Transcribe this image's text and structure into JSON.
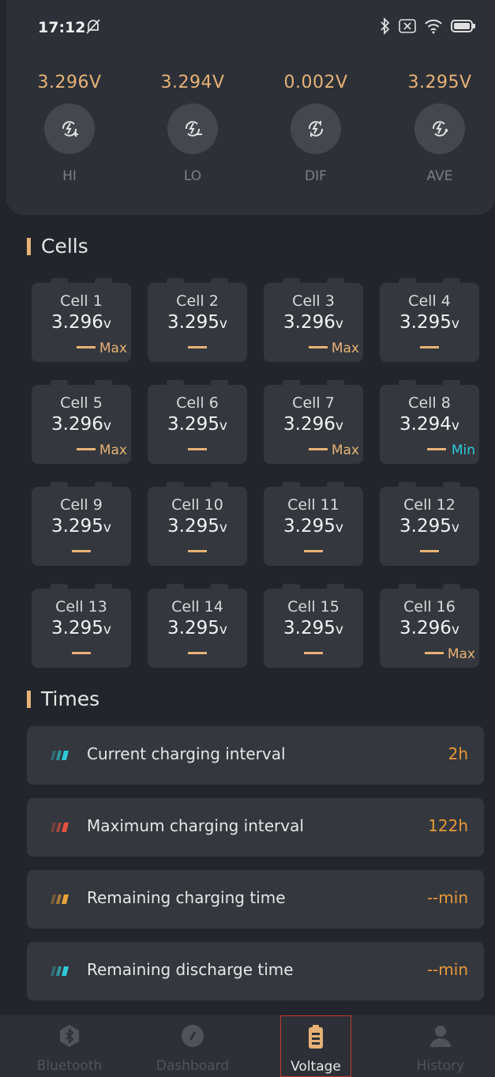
{
  "status_bar": {
    "time": "17:12"
  },
  "summary": [
    {
      "value": "3.296V",
      "label": "HI",
      "icon": "bolt-plus-icon"
    },
    {
      "value": "3.294V",
      "label": "LO",
      "icon": "bolt-minus-icon"
    },
    {
      "value": "0.002V",
      "label": "DIF",
      "icon": "bolt-cycle-icon"
    },
    {
      "value": "3.295V",
      "label": "AVE",
      "icon": "bolt-arrow-icon"
    }
  ],
  "sections": {
    "cells_title": "Cells",
    "times_title": "Times"
  },
  "cells": [
    {
      "name": "Cell 1",
      "voltage": "3.296",
      "unit": "v",
      "tag": "Max"
    },
    {
      "name": "Cell 2",
      "voltage": "3.295",
      "unit": "v",
      "tag": ""
    },
    {
      "name": "Cell 3",
      "voltage": "3.296",
      "unit": "v",
      "tag": "Max"
    },
    {
      "name": "Cell 4",
      "voltage": "3.295",
      "unit": "v",
      "tag": ""
    },
    {
      "name": "Cell 5",
      "voltage": "3.296",
      "unit": "v",
      "tag": "Max"
    },
    {
      "name": "Cell 6",
      "voltage": "3.295",
      "unit": "v",
      "tag": ""
    },
    {
      "name": "Cell 7",
      "voltage": "3.296",
      "unit": "v",
      "tag": "Max"
    },
    {
      "name": "Cell 8",
      "voltage": "3.294",
      "unit": "v",
      "tag": "Min"
    },
    {
      "name": "Cell 9",
      "voltage": "3.295",
      "unit": "v",
      "tag": ""
    },
    {
      "name": "Cell 10",
      "voltage": "3.295",
      "unit": "v",
      "tag": ""
    },
    {
      "name": "Cell 11",
      "voltage": "3.295",
      "unit": "v",
      "tag": ""
    },
    {
      "name": "Cell 12",
      "voltage": "3.295",
      "unit": "v",
      "tag": ""
    },
    {
      "name": "Cell 13",
      "voltage": "3.295",
      "unit": "v",
      "tag": ""
    },
    {
      "name": "Cell 14",
      "voltage": "3.295",
      "unit": "v",
      "tag": ""
    },
    {
      "name": "Cell 15",
      "voltage": "3.295",
      "unit": "v",
      "tag": ""
    },
    {
      "name": "Cell 16",
      "voltage": "3.296",
      "unit": "v",
      "tag": "Max"
    }
  ],
  "times": [
    {
      "label": "Current charging interval",
      "value": "2h",
      "icon_color": "#2ec9d6"
    },
    {
      "label": "Maximum charging interval",
      "value": "122h",
      "icon_color": "#e0523f"
    },
    {
      "label": "Remaining charging time",
      "value": "--min",
      "icon_color": "#e6a23c"
    },
    {
      "label": "Remaining discharge time",
      "value": "--min",
      "icon_color": "#2ec9d6"
    }
  ],
  "nav": [
    {
      "label": "Bluetooth",
      "icon": "bluetooth-icon",
      "active": false
    },
    {
      "label": "Dashboard",
      "icon": "dashboard-icon",
      "active": false
    },
    {
      "label": "Voltage",
      "icon": "battery-icon",
      "active": true
    },
    {
      "label": "History",
      "icon": "user-icon",
      "active": false
    }
  ],
  "colors": {
    "accent": "#e6b277",
    "min": "#2ec9d6",
    "background": "#22252b",
    "card": "#34373d"
  }
}
